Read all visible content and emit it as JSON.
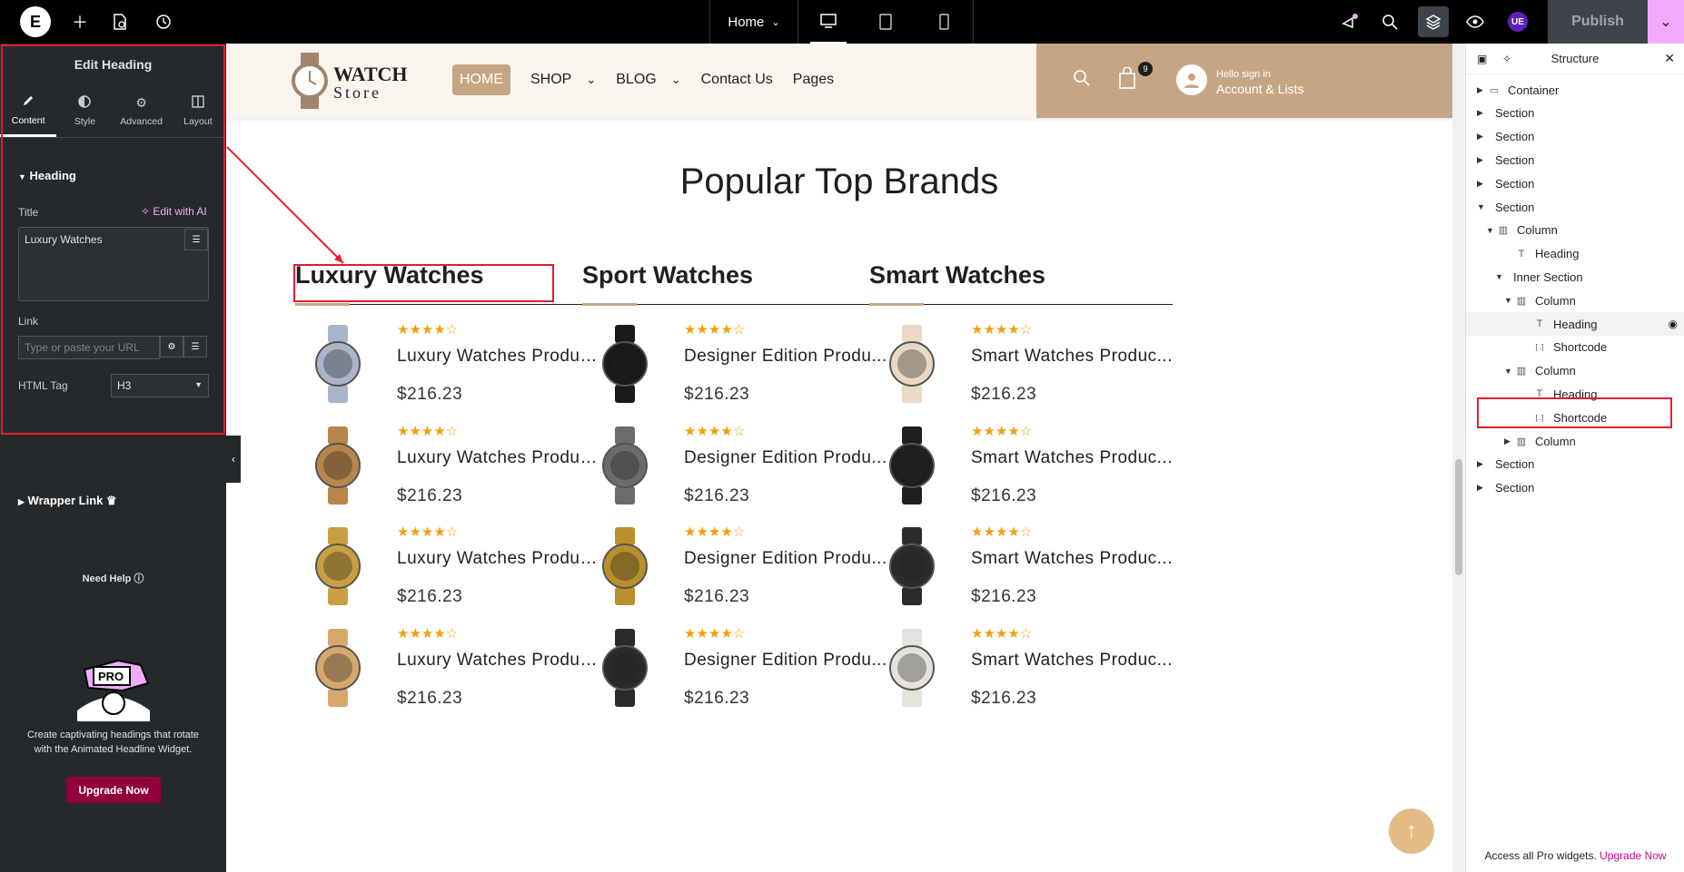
{
  "topbar": {
    "page_label": "Home",
    "publish_label": "Publish",
    "user_initials": "UE"
  },
  "left_panel": {
    "title": "Edit Heading",
    "tabs": [
      {
        "label": "Content",
        "icon": "pencil-icon"
      },
      {
        "label": "Style",
        "icon": "half-circle-icon"
      },
      {
        "label": "Advanced",
        "icon": "gear-icon"
      },
      {
        "label": "Layout",
        "icon": "layout-icon"
      }
    ],
    "section_title": "Heading",
    "title_label": "Title",
    "edit_ai_label": "Edit with AI",
    "title_value": "Luxury Watches",
    "link_label": "Link",
    "link_placeholder": "Type or paste your URL",
    "html_tag_label": "HTML Tag",
    "html_tag_value": "H3",
    "wrapper_link_label": "Wrapper Link",
    "need_help_label": "Need Help",
    "promo_badge": "PRO",
    "promo_text": "Create captivating headings that rotate with the Animated Headline Widget.",
    "upgrade_label": "Upgrade Now"
  },
  "site": {
    "brand_line1": "WATCH",
    "brand_line2": "Store",
    "nav": [
      "HOME",
      "SHOP",
      "BLOG",
      "Contact Us",
      "Pages"
    ],
    "cart_count": "9",
    "account_line1": "Hello sign in",
    "account_line2": "Account & Lists",
    "section_title": "Popular Top Brands",
    "columns": [
      {
        "heading": "Luxury Watches",
        "products": [
          {
            "name": "Luxury Watches Produc...",
            "price": "$216.23",
            "rating": 4,
            "color": "#a9b5c9"
          },
          {
            "name": "Luxury Watches Produc...",
            "price": "$216.23",
            "rating": 4,
            "color": "#b8864a"
          },
          {
            "name": "Luxury Watches Produc...",
            "price": "$216.23",
            "rating": 4,
            "color": "#c9a041"
          },
          {
            "name": "Luxury Watches Produc...",
            "price": "$216.23",
            "rating": 4,
            "color": "#d7a86e"
          }
        ]
      },
      {
        "heading": "Sport Watches",
        "products": [
          {
            "name": "Designer Edition Produ...",
            "price": "$216.23",
            "rating": 4,
            "color": "#1a1a1a"
          },
          {
            "name": "Designer Edition Produ...",
            "price": "$216.23",
            "rating": 4,
            "color": "#6b6b6b"
          },
          {
            "name": "Designer Edition Produ...",
            "price": "$216.23",
            "rating": 4,
            "color": "#b88f2c"
          },
          {
            "name": "Designer Edition Produ...",
            "price": "$216.23",
            "rating": 4,
            "color": "#2a2a2a"
          }
        ]
      },
      {
        "heading": "Smart Watches",
        "products": [
          {
            "name": "Smart Watches Produc...",
            "price": "$216.23",
            "rating": 4,
            "color": "#e9d8c3"
          },
          {
            "name": "Smart Watches Produc...",
            "price": "$216.23",
            "rating": 4,
            "color": "#1f1f1f"
          },
          {
            "name": "Smart Watches Produc...",
            "price": "$216.23",
            "rating": 4,
            "color": "#2b2b2b"
          },
          {
            "name": "Smart Watches Produc...",
            "price": "$216.23",
            "rating": 4,
            "color": "#e5e2dc"
          }
        ]
      }
    ]
  },
  "structure": {
    "title": "Structure",
    "items": [
      {
        "label": "Container",
        "depth": 0,
        "caret": "right",
        "icon": "container-icon"
      },
      {
        "label": "Section",
        "depth": 0,
        "caret": "right",
        "icon": ""
      },
      {
        "label": "Section",
        "depth": 0,
        "caret": "right",
        "icon": ""
      },
      {
        "label": "Section",
        "depth": 0,
        "caret": "right",
        "icon": ""
      },
      {
        "label": "Section",
        "depth": 0,
        "caret": "right",
        "icon": ""
      },
      {
        "label": "Section",
        "depth": 0,
        "caret": "down",
        "icon": ""
      },
      {
        "label": "Column",
        "depth": 1,
        "caret": "down",
        "icon": "column-icon"
      },
      {
        "label": "Heading",
        "depth": 2,
        "caret": "",
        "icon": "heading-icon"
      },
      {
        "label": "Inner Section",
        "depth": 2,
        "caret": "down",
        "icon": ""
      },
      {
        "label": "Column",
        "depth": 3,
        "caret": "down",
        "icon": "column-icon"
      },
      {
        "label": "Heading",
        "depth": 4,
        "caret": "",
        "icon": "heading-icon",
        "selected": true
      },
      {
        "label": "Shortcode",
        "depth": 4,
        "caret": "",
        "icon": "shortcode-icon"
      },
      {
        "label": "Column",
        "depth": 3,
        "caret": "down",
        "icon": "column-icon"
      },
      {
        "label": "Heading",
        "depth": 4,
        "caret": "",
        "icon": "heading-icon"
      },
      {
        "label": "Shortcode",
        "depth": 4,
        "caret": "",
        "icon": "shortcode-icon"
      },
      {
        "label": "Column",
        "depth": 3,
        "caret": "right",
        "icon": "column-icon"
      },
      {
        "label": "Section",
        "depth": 0,
        "caret": "right",
        "icon": ""
      },
      {
        "label": "Section",
        "depth": 0,
        "caret": "right",
        "icon": ""
      }
    ],
    "footer_text": "Access all Pro widgets.",
    "footer_link": "Upgrade Now"
  },
  "colors": {
    "accent": "#c6a584",
    "highlight": "#e11d2f",
    "pro_pink": "#f0abfc",
    "upgrade_bg": "#92003b"
  }
}
